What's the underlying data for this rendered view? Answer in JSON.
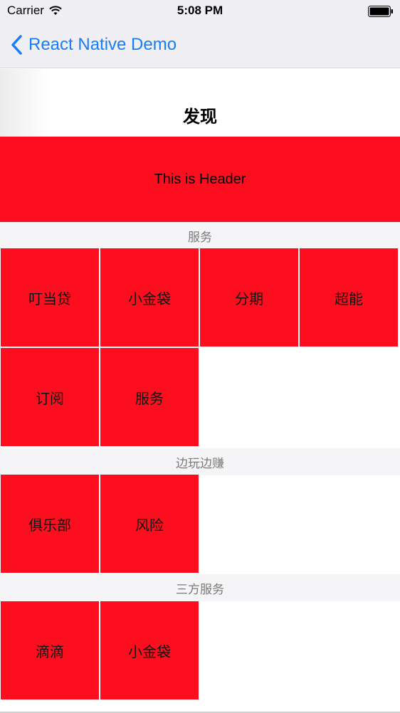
{
  "status_bar": {
    "carrier": "Carrier",
    "time": "5:08 PM",
    "wifi_icon": "wifi-icon",
    "battery_icon": "battery-full-icon"
  },
  "nav": {
    "back_label": "React Native Demo",
    "back_icon": "chevron-left-icon",
    "tint_color": "#1a7cf9"
  },
  "page": {
    "title": "发现",
    "header_text": "This is Header",
    "accent_color": "#fd0e1f"
  },
  "sections": [
    {
      "title": "服务",
      "items": [
        "叮当贷",
        "小金袋",
        "分期",
        "超能",
        "订阅",
        "服务"
      ]
    },
    {
      "title": "边玩边赚",
      "items": [
        "俱乐部",
        "风险"
      ]
    },
    {
      "title": "三方服务",
      "items": [
        "滴滴",
        "小金袋"
      ]
    }
  ]
}
